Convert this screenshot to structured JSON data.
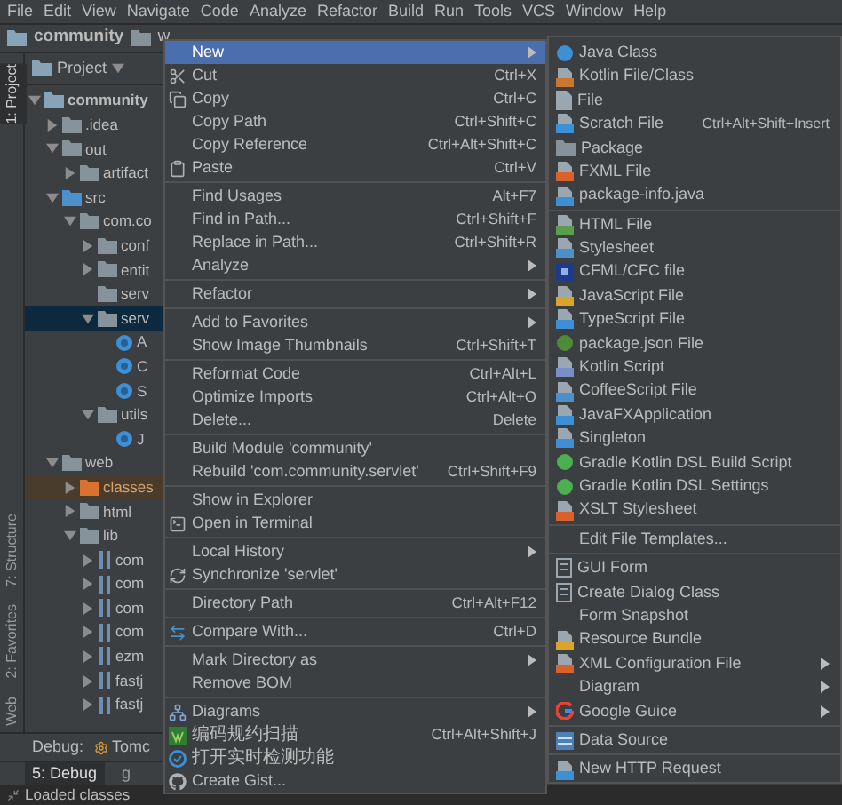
{
  "menu_bar": [
    "File",
    "Edit",
    "View",
    "Navigate",
    "Code",
    "Analyze",
    "Refactor",
    "Build",
    "Run",
    "Tools",
    "VCS",
    "Window",
    "Help"
  ],
  "breadcrumb": [
    "community",
    "w"
  ],
  "tool_strip": [
    {
      "label": "1: Project",
      "selected": true
    },
    {
      "label": "7: Structure",
      "selected": false
    },
    {
      "label": "2: Favorites",
      "selected": false
    },
    {
      "label": "Web",
      "selected": false
    }
  ],
  "project_panel": {
    "title": "Project",
    "tree": [
      {
        "label": "community",
        "kind": "module",
        "expanded": true,
        "selected": false,
        "children": [
          {
            "label": ".idea",
            "kind": "folder",
            "expanded": false,
            "selected": false
          },
          {
            "label": "out",
            "kind": "folder",
            "expanded": true,
            "selected": false,
            "children": [
              {
                "label": "artifact",
                "kind": "folder",
                "expanded": false,
                "selected": false
              }
            ]
          },
          {
            "label": "src",
            "kind": "source",
            "expanded": true,
            "selected": false,
            "children": [
              {
                "label": "com.co",
                "kind": "folder",
                "expanded": true,
                "selected": false,
                "children": [
                  {
                    "label": "conf",
                    "kind": "folder",
                    "expanded": false,
                    "selected": false
                  },
                  {
                    "label": "entit",
                    "kind": "folder",
                    "expanded": false,
                    "selected": false
                  },
                  {
                    "label": "serv",
                    "kind": "package",
                    "selected": false
                  },
                  {
                    "label": "serv",
                    "kind": "folder",
                    "expanded": true,
                    "selected": true,
                    "children": [
                      {
                        "label": "A",
                        "kind": "class",
                        "selected": false
                      },
                      {
                        "label": "C",
                        "kind": "class",
                        "selected": false
                      },
                      {
                        "label": "S",
                        "kind": "class",
                        "selected": false
                      }
                    ]
                  },
                  {
                    "label": "utils",
                    "kind": "folder",
                    "expanded": true,
                    "selected": false,
                    "children": [
                      {
                        "label": "J",
                        "kind": "class",
                        "selected": false
                      }
                    ]
                  }
                ]
              }
            ]
          },
          {
            "label": "web",
            "kind": "folder",
            "expanded": true,
            "selected": false,
            "children": [
              {
                "label": "classes",
                "kind": "excluded",
                "expanded": false,
                "selected": false
              },
              {
                "label": "html",
                "kind": "folder",
                "expanded": false,
                "selected": false
              },
              {
                "label": "lib",
                "kind": "folder",
                "expanded": true,
                "selected": false,
                "children": [
                  {
                    "label": "com",
                    "kind": "jar",
                    "expanded": false,
                    "selected": false
                  },
                  {
                    "label": "com",
                    "kind": "jar",
                    "expanded": false,
                    "selected": false
                  },
                  {
                    "label": "com",
                    "kind": "jar",
                    "expanded": false,
                    "selected": false
                  },
                  {
                    "label": "com",
                    "kind": "jar",
                    "expanded": false,
                    "selected": false
                  },
                  {
                    "label": "ezm",
                    "kind": "jar",
                    "expanded": false,
                    "selected": false
                  },
                  {
                    "label": "fastj",
                    "kind": "jar",
                    "expanded": false,
                    "selected": false
                  },
                  {
                    "label": "fastj",
                    "kind": "jar",
                    "expanded": false,
                    "selected": false
                  }
                ]
              }
            ]
          }
        ]
      }
    ]
  },
  "debug_bar": {
    "label": "Debug:",
    "tab": "Tomc"
  },
  "bottom_tabs": [
    {
      "label": "5: Debug",
      "selected": true
    },
    {
      "label": "g",
      "selected": false
    }
  ],
  "console_line": "Loaded classes",
  "context_menu": {
    "groups": [
      [
        {
          "label": "New",
          "submenu": true,
          "selected": true
        },
        {
          "label": "Cut",
          "shortcut": "Ctrl+X",
          "submenu": false,
          "selected": false
        },
        {
          "label": "Copy",
          "shortcut": "Ctrl+C",
          "submenu": false,
          "selected": false
        },
        {
          "label": "Copy Path",
          "shortcut": "Ctrl+Shift+C",
          "submenu": false,
          "selected": false
        },
        {
          "label": "Copy Reference",
          "shortcut": "Ctrl+Alt+Shift+C",
          "submenu": false,
          "selected": false
        },
        {
          "label": "Paste",
          "shortcut": "Ctrl+V",
          "submenu": false,
          "selected": false
        }
      ],
      [
        {
          "label": "Find Usages",
          "shortcut": "Alt+F7",
          "submenu": false,
          "selected": false
        },
        {
          "label": "Find in Path...",
          "shortcut": "Ctrl+Shift+F",
          "submenu": false,
          "selected": false
        },
        {
          "label": "Replace in Path...",
          "shortcut": "Ctrl+Shift+R",
          "submenu": false,
          "selected": false
        },
        {
          "label": "Analyze",
          "submenu": true,
          "selected": false
        }
      ],
      [
        {
          "label": "Refactor",
          "submenu": true,
          "selected": false
        }
      ],
      [
        {
          "label": "Add to Favorites",
          "submenu": true,
          "selected": false
        },
        {
          "label": "Show Image Thumbnails",
          "shortcut": "Ctrl+Shift+T",
          "submenu": false,
          "selected": false
        }
      ],
      [
        {
          "label": "Reformat Code",
          "shortcut": "Ctrl+Alt+L",
          "submenu": false,
          "selected": false
        },
        {
          "label": "Optimize Imports",
          "shortcut": "Ctrl+Alt+O",
          "submenu": false,
          "selected": false
        },
        {
          "label": "Delete...",
          "shortcut": "Delete",
          "submenu": false,
          "selected": false
        }
      ],
      [
        {
          "label": "Build Module 'community'",
          "submenu": false,
          "selected": false
        },
        {
          "label": "Rebuild 'com.community.servlet'",
          "shortcut": "Ctrl+Shift+F9",
          "submenu": false,
          "selected": false
        }
      ],
      [
        {
          "label": "Show in Explorer",
          "submenu": false,
          "selected": false
        },
        {
          "label": "Open in Terminal",
          "submenu": false,
          "selected": false
        }
      ],
      [
        {
          "label": "Local History",
          "submenu": true,
          "selected": false
        },
        {
          "label": "Synchronize 'servlet'",
          "submenu": false,
          "selected": false
        }
      ],
      [
        {
          "label": "Directory Path",
          "shortcut": "Ctrl+Alt+F12",
          "submenu": false,
          "selected": false
        }
      ],
      [
        {
          "label": "Compare With...",
          "shortcut": "Ctrl+D",
          "submenu": false,
          "selected": false
        }
      ],
      [
        {
          "label": "Mark Directory as",
          "submenu": true,
          "selected": false
        },
        {
          "label": "Remove BOM",
          "submenu": false,
          "selected": false
        }
      ],
      [
        {
          "label": "Diagrams",
          "submenu": true,
          "selected": false
        },
        {
          "label": "编码规约扫描",
          "shortcut": "Ctrl+Alt+Shift+J",
          "submenu": false,
          "selected": false
        },
        {
          "label": "打开实时检测功能",
          "submenu": false,
          "selected": false
        },
        {
          "label": "Create Gist...",
          "submenu": false,
          "selected": false
        }
      ]
    ]
  },
  "new_submenu": {
    "groups": [
      [
        {
          "label": "Java Class",
          "submenu": false
        },
        {
          "label": "Kotlin File/Class",
          "submenu": false
        },
        {
          "label": "File",
          "submenu": false
        },
        {
          "label": "Scratch File",
          "shortcut": "Ctrl+Alt+Shift+Insert",
          "submenu": false
        },
        {
          "label": "Package",
          "submenu": false
        },
        {
          "label": "FXML File",
          "submenu": false
        },
        {
          "label": "package-info.java",
          "submenu": false
        }
      ],
      [
        {
          "label": "HTML File",
          "submenu": false
        },
        {
          "label": "Stylesheet",
          "submenu": false
        },
        {
          "label": "CFML/CFC file",
          "submenu": false
        },
        {
          "label": "JavaScript File",
          "submenu": false
        },
        {
          "label": "TypeScript File",
          "submenu": false
        },
        {
          "label": "package.json File",
          "submenu": false
        },
        {
          "label": "Kotlin Script",
          "submenu": false
        },
        {
          "label": "CoffeeScript File",
          "submenu": false
        },
        {
          "label": "JavaFXApplication",
          "submenu": false
        },
        {
          "label": "Singleton",
          "submenu": false
        },
        {
          "label": "Gradle Kotlin DSL Build Script",
          "submenu": false
        },
        {
          "label": "Gradle Kotlin DSL Settings",
          "submenu": false
        },
        {
          "label": "XSLT Stylesheet",
          "submenu": false
        }
      ],
      [
        {
          "label": "Edit File Templates...",
          "submenu": false
        }
      ],
      [
        {
          "label": "GUI Form",
          "submenu": false
        },
        {
          "label": "Create Dialog Class",
          "submenu": false
        },
        {
          "label": "Form Snapshot",
          "submenu": false
        },
        {
          "label": "Resource Bundle",
          "submenu": false
        },
        {
          "label": "XML Configuration File",
          "submenu": true
        },
        {
          "label": "Diagram",
          "submenu": true
        },
        {
          "label": "Google Guice",
          "submenu": true
        }
      ],
      [
        {
          "label": "Data Source",
          "submenu": false
        }
      ],
      [
        {
          "label": "New HTTP Request",
          "submenu": false
        }
      ]
    ]
  }
}
